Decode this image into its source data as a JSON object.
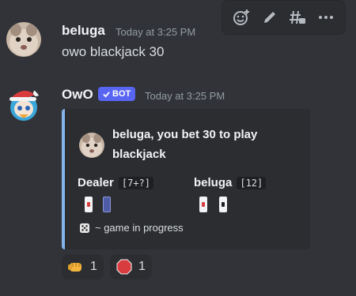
{
  "toolbar": {
    "icons": [
      "add-reaction-icon",
      "pencil-icon",
      "thread-icon",
      "more-icon"
    ]
  },
  "message1": {
    "username": "beluga",
    "timestamp": "Today at 3:25 PM",
    "content": "owo blackjack 30"
  },
  "message2": {
    "username": "OwO",
    "bot_tag": "BOT",
    "timestamp": "Today at 3:25 PM",
    "embed": {
      "accent_color": "#85b3e9",
      "title": "beluga, you bet 30 to play blackjack",
      "dealer": {
        "name": "Dealer",
        "score": "[7+?]"
      },
      "player": {
        "name": "beluga",
        "score": "[12]"
      },
      "footer_icon": "dice-icon",
      "footer_text": "~ game in progress"
    }
  },
  "reactions": [
    {
      "emoji": "punch-emoji",
      "count": "1"
    },
    {
      "emoji": "stop-sign-emoji",
      "count": "1"
    }
  ]
}
